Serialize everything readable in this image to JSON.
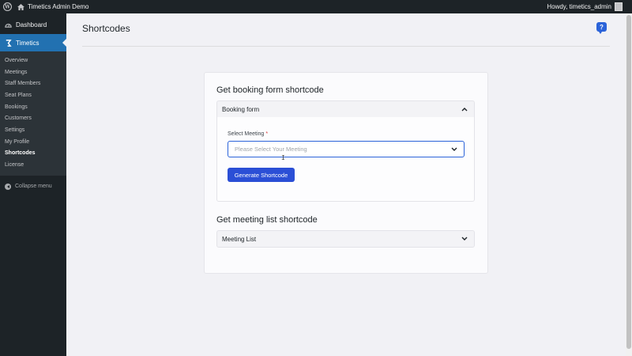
{
  "adminbar": {
    "site_name": "Timetics Admin Demo",
    "howdy": "Howdy, timetics_admin"
  },
  "sidebar": {
    "dashboard": "Dashboard",
    "plugin": "Timetics",
    "items": [
      {
        "label": "Overview"
      },
      {
        "label": "Meetings"
      },
      {
        "label": "Staff Members"
      },
      {
        "label": "Seat Plans"
      },
      {
        "label": "Bookings"
      },
      {
        "label": "Customers"
      },
      {
        "label": "Settings"
      },
      {
        "label": "My Profile"
      },
      {
        "label": "Shortcodes"
      },
      {
        "label": "License"
      }
    ],
    "current": "Shortcodes",
    "collapse": "Collapse menu"
  },
  "page": {
    "title": "Shortcodes",
    "help_glyph": "?"
  },
  "booking_section": {
    "title": "Get booking form shortcode",
    "accordion_label": "Booking form",
    "field_label": "Select Meeting",
    "required_mark": "*",
    "placeholder": "Please Select Your Meeting",
    "button_label": "Generate Shortcode"
  },
  "meeting_section": {
    "title": "Get meeting list shortcode",
    "accordion_label": "Meeting List"
  },
  "colors": {
    "admin_dark": "#1d2327",
    "accent_blue": "#2271b1",
    "button_blue": "#2b4fd6"
  },
  "icons": {
    "wp": "wordpress-icon",
    "home": "home-icon",
    "dashboard": "dashboard-icon",
    "timetics": "timetics-icon",
    "help": "help-chat-icon",
    "expand_up": "chevron-up-icon",
    "expand_down": "chevron-down-icon"
  }
}
